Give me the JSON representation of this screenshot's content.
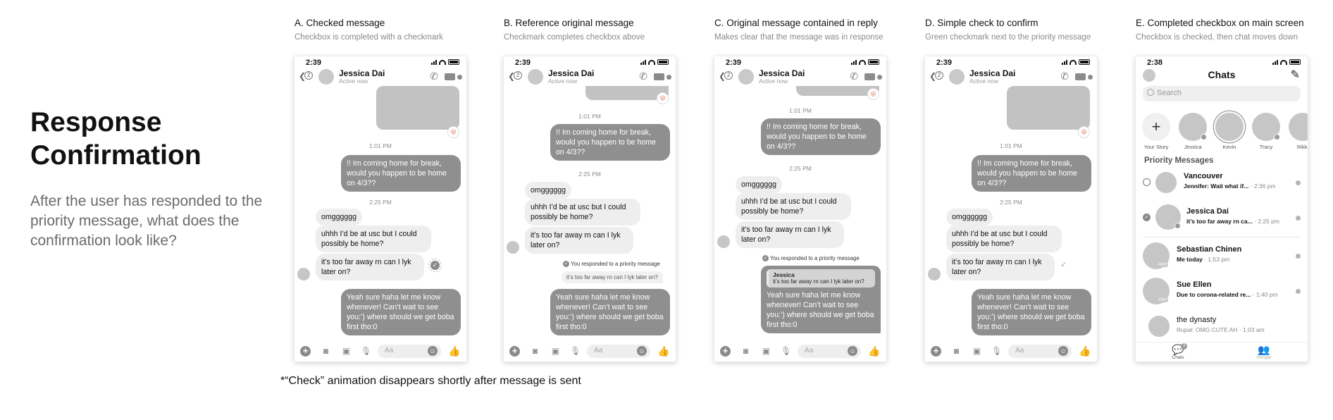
{
  "intro": {
    "title": "Response Confirmation",
    "body": "After the user has responded to the priority message, what does the confirmation look like?"
  },
  "footnote": "*“Check” animation disappears shortly after message is sent",
  "columns": [
    {
      "title": "A. Checked message",
      "subtitle": "Checkbox is completed with a checkmark"
    },
    {
      "title": "B. Reference original message",
      "subtitle": "Checkmark completes checkbox above"
    },
    {
      "title": "C. Original message contained in reply",
      "subtitle": "Makes clear that the message was in response"
    },
    {
      "title": "D. Simple check to confirm",
      "subtitle": "Green checkmark next to the priority message"
    },
    {
      "title": "E. Completed checkbox on main screen",
      "subtitle": "Checkbox is checked, then chat moves down"
    }
  ],
  "status": {
    "time_chat": "2:39",
    "time_chats": "2:38"
  },
  "chat": {
    "back_count": "2",
    "name": "Jessica Dai",
    "status": "Active now",
    "ts_1": "1:01 PM",
    "ts_2": "2:25 PM",
    "msg_out_1": "!! Im coming home for break, would you happen to be home on 4/3??",
    "msg_in_1": "omgggggg",
    "msg_in_2": "uhhh I’d be at usc but I could possibly be home?",
    "msg_in_3": "it’s too far away rn can I lyk later on?",
    "msg_out_2": "Yeah sure haha let me know whenever! Can’t wait to see you:’) where should we get boba first tho:0",
    "responded_note": "You responded to a priority message",
    "quote_text": "it’s too far away rn can I lyk later on?",
    "quote_author": "Jessica",
    "composer_placeholder": "Aa"
  },
  "chats_screen": {
    "title": "Chats",
    "search_placeholder": "Search",
    "stories": [
      "Your Story",
      "Jessica",
      "Kevin",
      "Tracy",
      "Rikki"
    ],
    "priority_label": "Priority Messages",
    "rows": [
      {
        "name": "Vancouver",
        "message": "Jennifer: Wait what if...",
        "time": "· 2:36 pm"
      },
      {
        "name": "Jessica Dai",
        "message": "it’s too far away rn ca...",
        "time": "· 2:25 pm"
      },
      {
        "name": "Sebastian Chinen",
        "message": "Me today",
        "time": "· 1:53 pm"
      },
      {
        "name": "Sue Ellen",
        "message": "Due to corona-related re...",
        "time": "· 1:40 pm"
      },
      {
        "name": "the dynasty",
        "message": "Rupal: OMG CUTE AH",
        "time": "· 1:03 am"
      }
    ],
    "avatar_hints": [
      "44m",
      "58m"
    ],
    "tabs": {
      "chats": "Chats",
      "people": "People",
      "chats_badge": "3"
    }
  },
  "icons": {
    "back": "chevron-left-icon",
    "call": "phone-icon",
    "video": "video-icon",
    "check": "checkmark-icon",
    "plus": "plus-icon",
    "camera": "camera-icon",
    "image": "image-icon",
    "mic": "microphone-icon",
    "emoji": "emoji-icon",
    "like": "thumbs-up-icon",
    "edit": "compose-icon",
    "search": "search-icon"
  },
  "colors": {
    "accent_check": "#7dc36b",
    "bubble_out": "#8f8f8f",
    "bubble_in": "#eeeeee"
  }
}
